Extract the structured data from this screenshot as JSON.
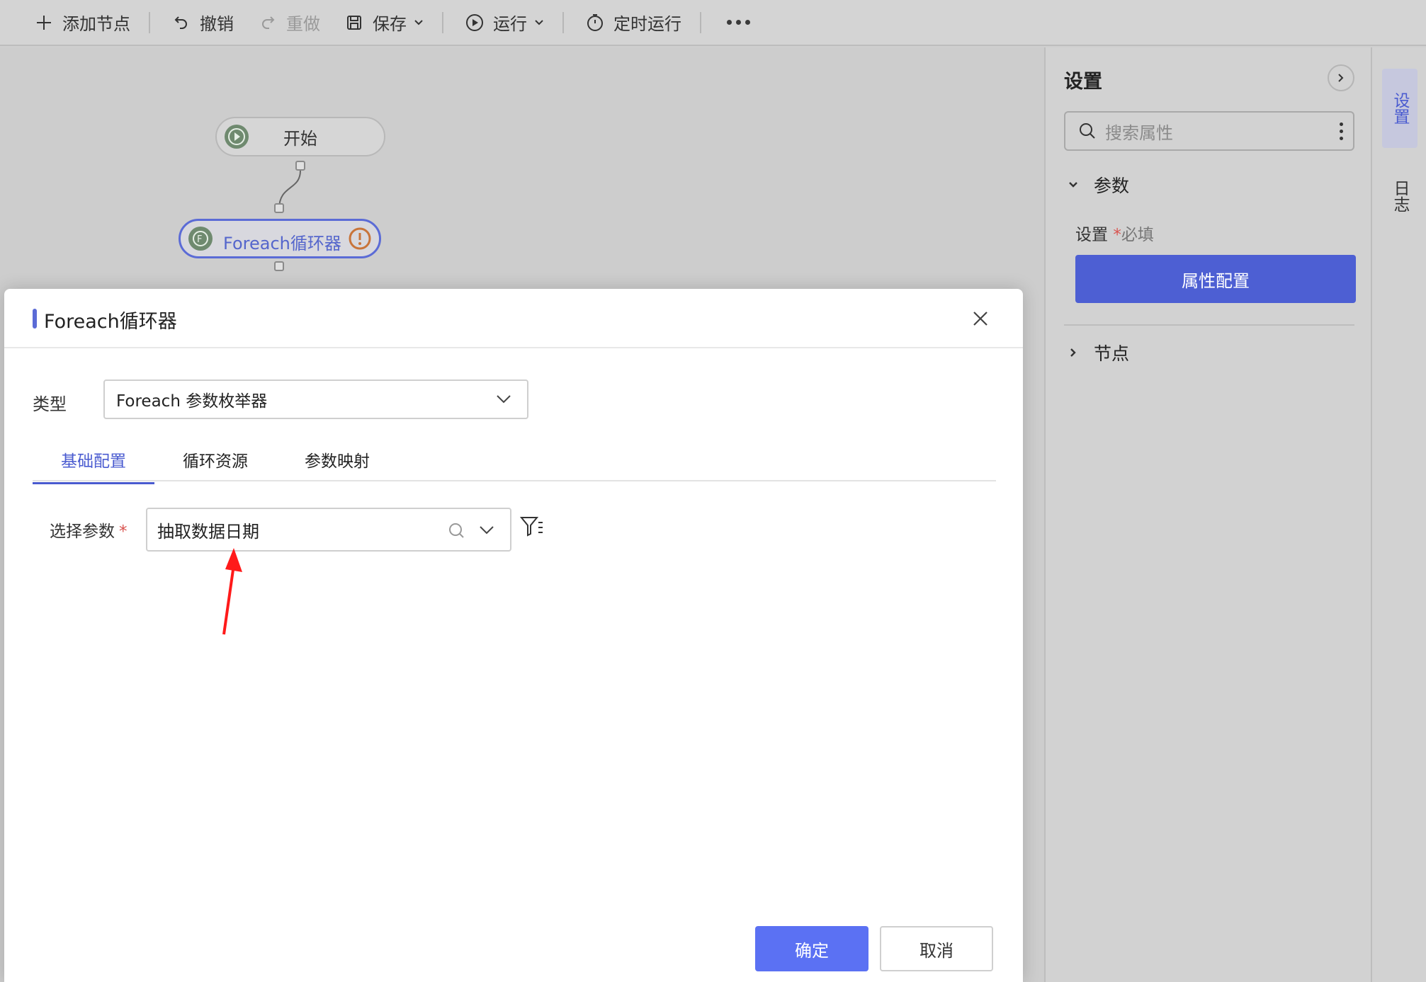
{
  "toolbar": {
    "add_node": "添加节点",
    "undo": "撤销",
    "redo": "重做",
    "save": "保存",
    "run": "运行",
    "scheduled_run": "定时运行"
  },
  "canvas": {
    "start_node": "开始",
    "foreach_node": "Foreach循环器"
  },
  "panel": {
    "title": "设置",
    "search_placeholder": "搜索属性",
    "section_params": "参数",
    "field_label": "设置",
    "required_mark": "*",
    "required_text": "必填",
    "prop_config_button": "属性配置",
    "section_nodes": "节点"
  },
  "side_tabs": {
    "settings": "设置",
    "log": "日志"
  },
  "modal": {
    "title": "Foreach循环器",
    "type_label": "类型",
    "type_value": "Foreach 参数枚举器",
    "tabs": [
      "基础配置",
      "循环资源",
      "参数映射"
    ],
    "param_label": "选择参数",
    "param_required": "*",
    "param_value": "抽取数据日期",
    "ok": "确定",
    "cancel": "取消"
  },
  "colors": {
    "accent": "#4d5fd3",
    "primary_button": "#5b71f3",
    "required": "#d9534f",
    "annotation_arrow": "#ff1a1a"
  }
}
